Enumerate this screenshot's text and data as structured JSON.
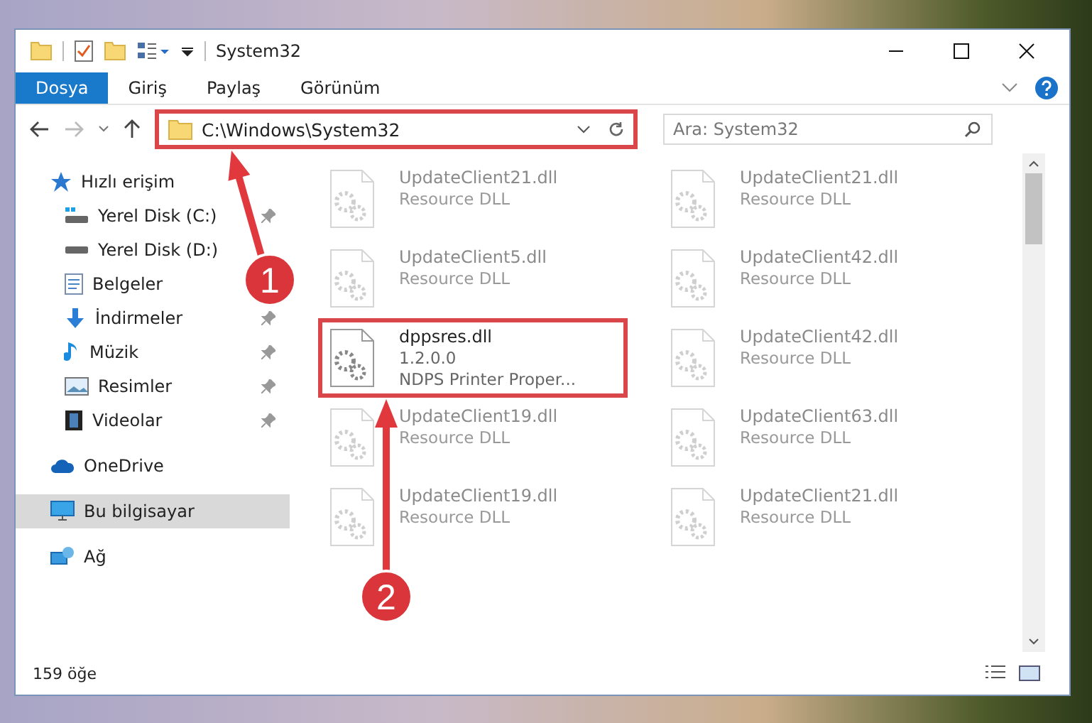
{
  "window": {
    "title": "System32"
  },
  "ribbon": [
    {
      "label": "Dosya",
      "kind": "file"
    },
    {
      "label": "Giriş",
      "kind": "tab"
    },
    {
      "label": "Paylaş",
      "kind": "tab"
    },
    {
      "label": "Görünüm",
      "kind": "tab"
    }
  ],
  "address": {
    "path": "C:\\Windows\\System32",
    "highlighted": true
  },
  "search": {
    "placeholder": "Ara: System32"
  },
  "sidebar": [
    {
      "label": "Hızlı erişim",
      "kind": "star",
      "selected": false,
      "children": [
        {
          "label": "Yerel Disk (C:)",
          "kind": "drive-c",
          "pinned": true,
          "selected": false
        },
        {
          "label": "Yerel Disk (D:)",
          "kind": "drive",
          "pinned": false,
          "selected": false
        },
        {
          "label": "Belgeler",
          "kind": "docs",
          "pinned": false,
          "selected": false
        },
        {
          "label": "İndirmeler",
          "kind": "download",
          "pinned": true,
          "selected": false
        },
        {
          "label": "Müzik",
          "kind": "music",
          "pinned": true,
          "selected": false
        },
        {
          "label": "Resimler",
          "kind": "pictures",
          "pinned": true,
          "selected": false
        },
        {
          "label": "Videolar",
          "kind": "videos",
          "pinned": true,
          "selected": false
        }
      ]
    },
    {
      "label": "OneDrive",
      "kind": "cloud",
      "selected": false
    },
    {
      "label": "Bu bilgisayar",
      "kind": "pc",
      "selected": true
    },
    {
      "label": "Ağ",
      "kind": "network",
      "selected": false
    }
  ],
  "files": [
    {
      "name": "UpdateClient21.dll",
      "lines": [
        "Resource DLL"
      ],
      "faded": true,
      "highlighted": false
    },
    {
      "name": "UpdateClient21.dll",
      "lines": [
        "Resource DLL"
      ],
      "faded": true,
      "highlighted": false
    },
    {
      "name": "UpdateClient5.dll",
      "lines": [
        "Resource DLL"
      ],
      "faded": true,
      "highlighted": false
    },
    {
      "name": "UpdateClient42.dll",
      "lines": [
        "Resource DLL"
      ],
      "faded": true,
      "highlighted": false
    },
    {
      "name": "dppsres.dll",
      "lines": [
        "1.2.0.0",
        "NDPS Printer Proper..."
      ],
      "faded": false,
      "highlighted": true
    },
    {
      "name": "UpdateClient42.dll",
      "lines": [
        "Resource DLL"
      ],
      "faded": true,
      "highlighted": false
    },
    {
      "name": "UpdateClient19.dll",
      "lines": [
        "Resource DLL"
      ],
      "faded": true,
      "highlighted": false
    },
    {
      "name": "UpdateClient63.dll",
      "lines": [
        "Resource DLL"
      ],
      "faded": true,
      "highlighted": false
    },
    {
      "name": "UpdateClient19.dll",
      "lines": [
        "Resource DLL"
      ],
      "faded": true,
      "highlighted": false
    },
    {
      "name": "UpdateClient21.dll",
      "lines": [
        "Resource DLL"
      ],
      "faded": true,
      "highlighted": false
    }
  ],
  "status_bar": {
    "count": "159 öğe"
  },
  "annotations": [
    {
      "label": "1"
    },
    {
      "label": "2"
    }
  ]
}
